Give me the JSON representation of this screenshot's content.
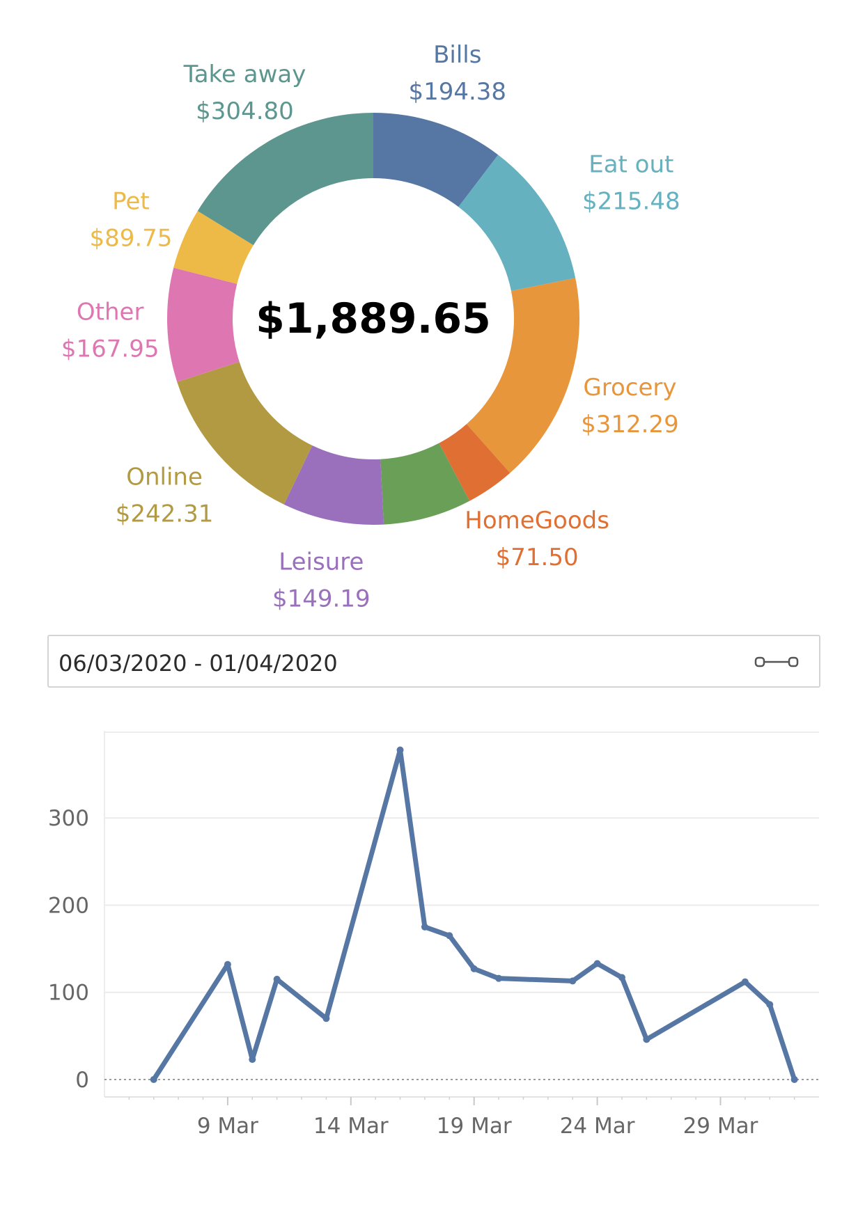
{
  "chart_data": [
    {
      "type": "pie",
      "donut": true,
      "total_label": "$1,889.65",
      "slices": [
        {
          "name": "Bills",
          "value": 194.38,
          "label": "$194.38",
          "color": "#5677a4"
        },
        {
          "name": "Eat out",
          "value": 215.48,
          "label": "$215.48",
          "color": "#65b1c0"
        },
        {
          "name": "Grocery",
          "value": 312.29,
          "label": "$312.29",
          "color": "#e8963c"
        },
        {
          "name": "HomeGoods",
          "value": 71.5,
          "label": "$71.50",
          "color": "#e06f33"
        },
        {
          "name": "",
          "value": 130.0,
          "label": "",
          "color": "#6a9f58"
        },
        {
          "name": "Leisure",
          "value": 149.19,
          "label": "$149.19",
          "color": "#9a70bd"
        },
        {
          "name": "Online",
          "value": 242.31,
          "label": "$242.31",
          "color": "#b29a42"
        },
        {
          "name": "Other",
          "value": 167.95,
          "label": "$167.95",
          "color": "#de77b1"
        },
        {
          "name": "Pet",
          "value": 89.75,
          "label": "$89.75",
          "color": "#edb947"
        },
        {
          "name": "Take away",
          "value": 304.8,
          "label": "$304.80",
          "color": "#5d968f"
        }
      ]
    },
    {
      "type": "line",
      "color": "#5677a4",
      "x": [
        "2020-03-06",
        "2020-03-09",
        "2020-03-10",
        "2020-03-11",
        "2020-03-13",
        "2020-03-16",
        "2020-03-17",
        "2020-03-18",
        "2020-03-19",
        "2020-03-20",
        "2020-03-23",
        "2020-03-24",
        "2020-03-25",
        "2020-03-26",
        "2020-03-30",
        "2020-03-31",
        "2020-04-01"
      ],
      "y": [
        0,
        132,
        23,
        115,
        70,
        378,
        175,
        165,
        127,
        116,
        113,
        133,
        117,
        46,
        112,
        86,
        0
      ],
      "xlim": [
        "2020-03-04",
        "2020-04-02"
      ],
      "ylim": [
        -20,
        400
      ],
      "yticks": [
        0,
        100,
        200,
        300
      ],
      "xtick_labels": [
        "9 Mar",
        "14 Mar",
        "19 Mar",
        "24 Mar",
        "29 Mar"
      ],
      "xtick_dates": [
        "2020-03-09",
        "2020-03-14",
        "2020-03-19",
        "2020-03-24",
        "2020-03-29"
      ],
      "grid": true
    }
  ],
  "filter": {
    "date_range": "06/03/2020 - 01/04/2020",
    "icon": "range-slider-icon"
  }
}
